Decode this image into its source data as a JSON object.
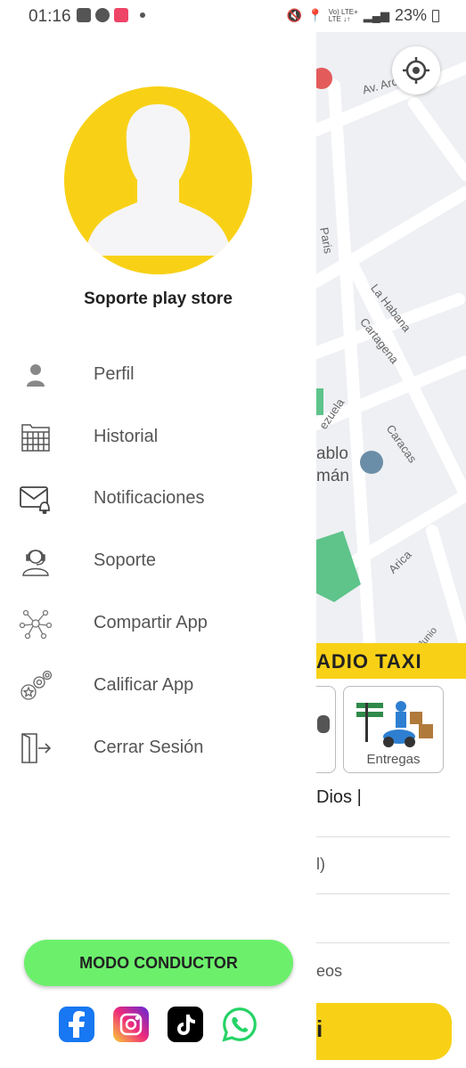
{
  "status_bar": {
    "time": "01:16",
    "battery": "23%",
    "net_top": "Vo) LTE+",
    "net_bottom": "LTE ↓↑"
  },
  "map": {
    "labels": [
      "Av. Arc",
      "Paris",
      "La Habana",
      "Cartagena",
      "ezuela",
      "Caracas",
      "ablo",
      "mán",
      "Arica",
      "Junio"
    ]
  },
  "profile": {
    "name": "Soporte play store"
  },
  "menu": [
    {
      "label": "Perfil",
      "icon": "person-icon"
    },
    {
      "label": "Historial",
      "icon": "calendar-folder-icon"
    },
    {
      "label": "Notificaciones",
      "icon": "mail-bell-icon"
    },
    {
      "label": "Soporte",
      "icon": "support-agent-icon"
    },
    {
      "label": "Compartir App",
      "icon": "share-network-icon"
    },
    {
      "label": "Calificar App",
      "icon": "rating-badges-icon"
    },
    {
      "label": "Cerrar Sesión",
      "icon": "logout-door-icon"
    }
  ],
  "driver_button": "MODO CONDUCTOR",
  "socials": [
    "facebook-icon",
    "instagram-icon",
    "tiktok-icon",
    "whatsapp-icon"
  ],
  "sheet": {
    "brand": "ADIO TAXI",
    "service_label": "Entregas",
    "destination": "Dios |",
    "row1": "l)",
    "row2": "eos",
    "button": "i"
  },
  "colors": {
    "brand_yellow": "#f8d117",
    "driver_green": "#6cf06c"
  }
}
